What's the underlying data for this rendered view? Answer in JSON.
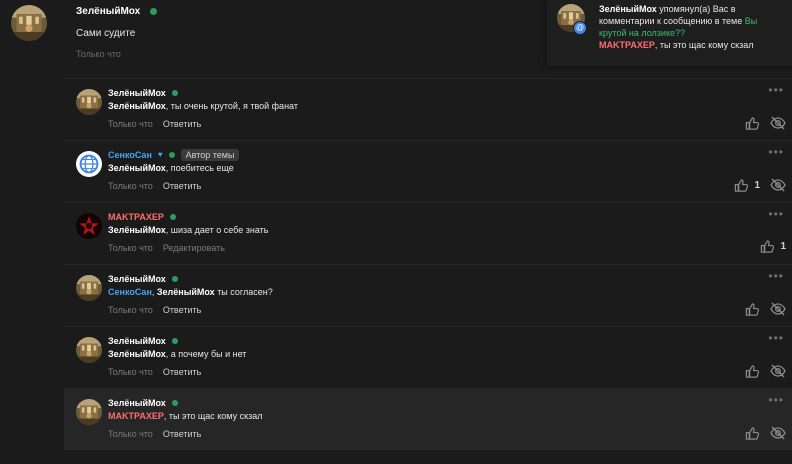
{
  "main_post": {
    "author": "ЗелёныйМох",
    "text": "Сами судите",
    "time": "Только что"
  },
  "notification": {
    "author": "ЗелёныйМох",
    "text_before": " упомянул(а) Вас в комментарии к сообщению в теме ",
    "topic": "Вы крутой на лолзике??",
    "quote_author": "MAKTPAXEP",
    "quote_text": ", ты это щас кому скзал"
  },
  "replies": [
    {
      "author": "ЗелёныйМох",
      "mention": "ЗелёныйМох",
      "text": ", ты очень крутой, я твой фанат",
      "time": "Только что",
      "action": "Ответить"
    },
    {
      "author": "СенкоСан",
      "badge": "Автор темы",
      "mention": "ЗелёныйМох",
      "text": ", поебитесь еще",
      "time": "Только что",
      "action": "Ответить",
      "likes": "1"
    },
    {
      "author": "MAKTPAXEP",
      "mention": "ЗелёныйМох",
      "text": ", шиза дает о себе знать",
      "time": "Только что",
      "action": "Редактировать",
      "likes": "1"
    },
    {
      "author": "ЗелёныйМох",
      "mention": "СенкоСан",
      "mention2": "ЗелёныйМох",
      "text": " ты согласен?",
      "time": "Только что",
      "action": "Ответить"
    },
    {
      "author": "ЗелёныйМох",
      "mention": "ЗелёныйМох",
      "text": ", а почему бы и нет",
      "time": "Только что",
      "action": "Ответить"
    },
    {
      "author": "ЗелёныйМох",
      "mention": "MAKTPAXEP",
      "text": ", ты это щас кому скзал",
      "time": "Только что",
      "action": "Ответить"
    }
  ],
  "colors": {
    "background": "#1b1b1b",
    "online": "#2d9d5e",
    "link_green": "#3fbb6c",
    "name_blue": "#42a5f5",
    "name_red": "#ff6d6d"
  },
  "icons": {
    "like": "thumbs-up-icon",
    "hide": "eye-off-icon",
    "more": "more-dots-icon",
    "mention": "at-sign-icon"
  }
}
